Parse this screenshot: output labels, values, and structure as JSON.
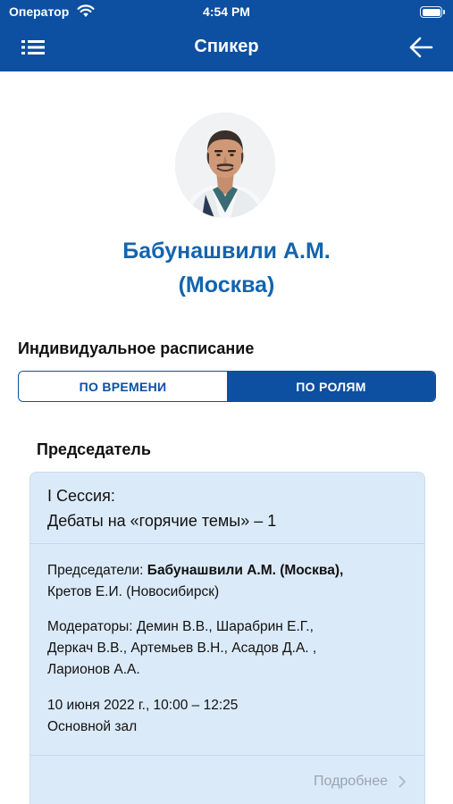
{
  "status_bar": {
    "carrier": "Оператор",
    "time": "4:54 PM",
    "wifi_icon": "wifi-icon",
    "battery_level": 1.0
  },
  "nav_bar": {
    "title": "Спикер",
    "menu_icon": "list-menu-icon",
    "back_icon": "arrow-left-icon",
    "color": "#0d4fa1"
  },
  "speaker": {
    "name": "Бабунашвили А.М.",
    "city": "(Москва)",
    "name_color": "#1464ad"
  },
  "schedule": {
    "title": "Индивидуальное расписание",
    "segments": [
      {
        "label": "ПО ВРЕМЕНИ",
        "selected": false
      },
      {
        "label": "ПО РОЛЯМ",
        "selected": true
      }
    ]
  },
  "role_section": {
    "title": "Председатель",
    "card": {
      "session_line1": "I Сессия:",
      "session_line2": "Дебаты на «горячие темы» – 1",
      "chairs_label": "Председатели:",
      "chairs_bold": "Бабунашвили А.М. (Москва),",
      "chairs_rest": "Кретов Е.И. (Новосибирск)",
      "moderators_line1": "Модераторы: Демин В.В., Шарабрин Е.Г.,",
      "moderators_line2": "Деркач В.В., Артемьев В.Н., Асадов Д.А. ,",
      "moderators_line3": "Ларионов А.А.",
      "datetime": "10 июня 2022 г., 10:00 – 12:25",
      "room": "Основной зал",
      "more_label": "Подробнее",
      "background": "#dbeaf8"
    }
  }
}
